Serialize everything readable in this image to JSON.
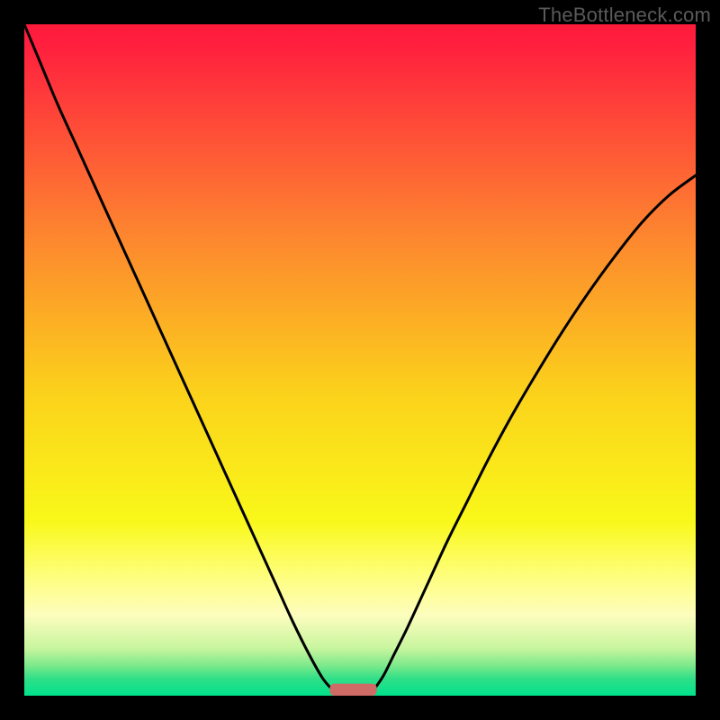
{
  "watermark": "TheBottleneck.com",
  "chart_data": {
    "type": "line",
    "title": "",
    "xlabel": "",
    "ylabel": "",
    "x_range": [
      0,
      100
    ],
    "y_range": [
      0,
      100
    ],
    "background_gradient": {
      "stops": [
        {
          "offset": 0.0,
          "color": "#ff1a3a"
        },
        {
          "offset": 0.03,
          "color": "#ff1f3e"
        },
        {
          "offset": 0.3,
          "color": "#fd8130"
        },
        {
          "offset": 0.55,
          "color": "#fbd21b"
        },
        {
          "offset": 0.74,
          "color": "#f9f81a"
        },
        {
          "offset": 0.82,
          "color": "#fefe7b"
        },
        {
          "offset": 0.88,
          "color": "#fdfdbe"
        },
        {
          "offset": 0.93,
          "color": "#c7f59e"
        },
        {
          "offset": 0.955,
          "color": "#7de98b"
        },
        {
          "offset": 0.975,
          "color": "#2fdf87"
        },
        {
          "offset": 1.0,
          "color": "#00e28c"
        }
      ]
    },
    "series": [
      {
        "name": "left-curve",
        "x": [
          0.0,
          2.5,
          5.0,
          7.5,
          10.0,
          12.5,
          15.0,
          17.5,
          20.0,
          22.5,
          25.0,
          27.5,
          30.0,
          32.5,
          35.0,
          37.5,
          40.0,
          42.5,
          44.5,
          46.0
        ],
        "y": [
          100.0,
          94.0,
          88.0,
          82.5,
          77.0,
          71.5,
          66.0,
          60.5,
          55.0,
          49.5,
          44.0,
          38.5,
          33.0,
          27.5,
          22.0,
          16.5,
          11.0,
          6.0,
          2.5,
          0.8
        ]
      },
      {
        "name": "right-curve",
        "x": [
          52.0,
          53.5,
          55.0,
          57.0,
          60.0,
          63.0,
          66.0,
          69.0,
          72.5,
          76.0,
          80.0,
          84.0,
          88.0,
          92.0,
          96.0,
          100.0
        ],
        "y": [
          0.8,
          3.0,
          6.0,
          10.0,
          16.5,
          23.0,
          29.0,
          35.0,
          41.5,
          47.5,
          54.0,
          60.0,
          65.5,
          70.5,
          74.5,
          77.5
        ]
      }
    ],
    "marker": {
      "name": "min-marker",
      "x_center": 49.0,
      "width": 7.0,
      "height": 1.8,
      "color": "#cf6b66"
    }
  }
}
